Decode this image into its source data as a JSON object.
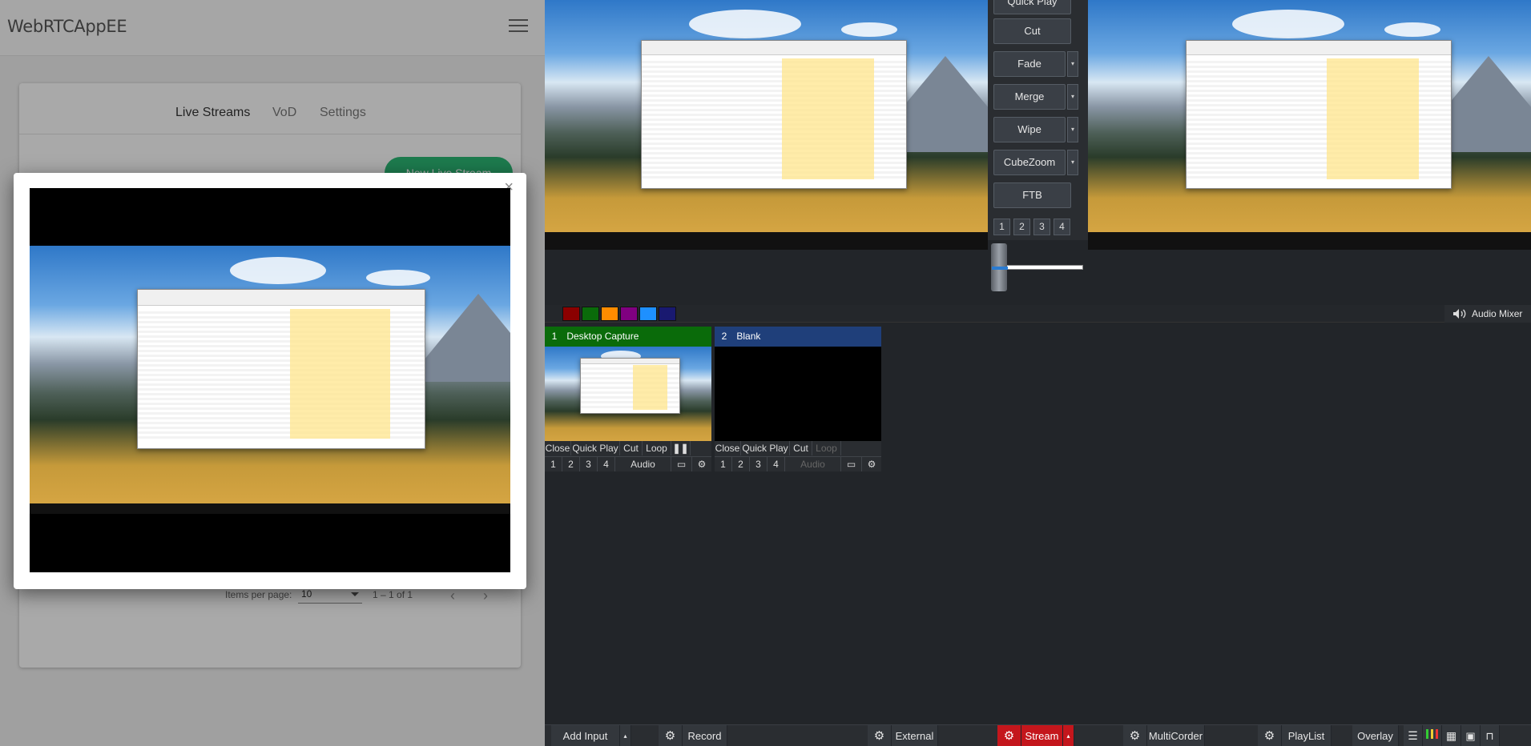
{
  "left_app": {
    "title": "WebRTCAppEE",
    "tabs": [
      "Live Streams",
      "VoD",
      "Settings"
    ],
    "new_stream_button": "New Live Stream",
    "items_per_page_label": "Items per page:",
    "items_per_page_value": "10",
    "range_label": "1 – 1 of 1"
  },
  "modal": {
    "close_label": "×"
  },
  "transitions": {
    "quick_play": "Quick Play",
    "cut": "Cut",
    "fade": "Fade",
    "merge": "Merge",
    "wipe": "Wipe",
    "cubezoom": "CubeZoom",
    "ftb": "FTB",
    "numbers": [
      "1",
      "2",
      "3",
      "4"
    ]
  },
  "color_swatches": [
    "#8b0000",
    "#0a6b0a",
    "#ff8c00",
    "#800080",
    "#1e90ff",
    "#191970"
  ],
  "audio_mixer_label": "Audio Mixer",
  "inputs": [
    {
      "number": "1",
      "name": "Desktop Capture",
      "title_color": "#0a6b0a",
      "controls": [
        "Close",
        "Quick Play",
        "Cut",
        "Loop"
      ],
      "pause_icon": "pause-icon",
      "overlays": [
        "1",
        "2",
        "3",
        "4"
      ],
      "audio": "Audio",
      "loop_dimmed": false,
      "audio_dimmed": false
    },
    {
      "number": "2",
      "name": "Blank",
      "title_color": "#1f3f7a",
      "controls": [
        "Close",
        "Quick Play",
        "Cut",
        "Loop"
      ],
      "overlays": [
        "1",
        "2",
        "3",
        "4"
      ],
      "audio": "Audio",
      "loop_dimmed": true,
      "audio_dimmed": true
    }
  ],
  "bottom_bar": {
    "add_input": "Add Input",
    "record": "Record",
    "external": "External",
    "stream": "Stream",
    "multicorder": "MultiCorder",
    "playlist": "PlayList",
    "overlay": "Overlay"
  }
}
